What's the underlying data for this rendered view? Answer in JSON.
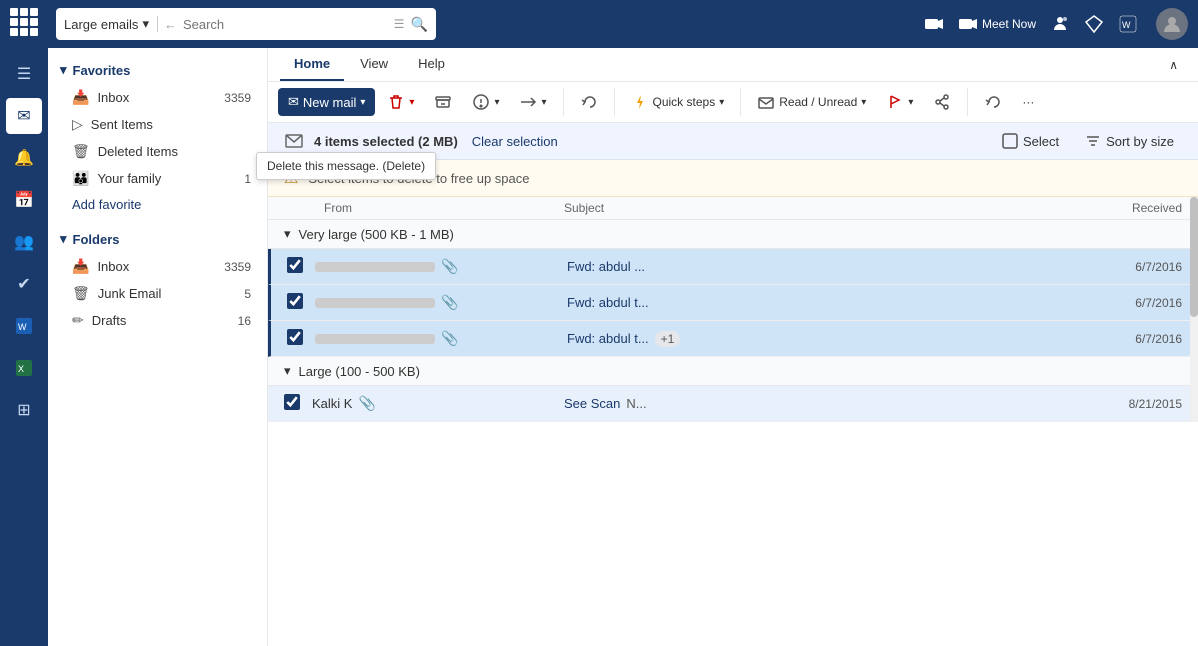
{
  "topbar": {
    "search_filter": "Large emails",
    "search_placeholder": "Search",
    "meet_now_label": "Meet Now",
    "icons": [
      "video-icon",
      "teams-icon",
      "diamond-icon",
      "word-icon"
    ]
  },
  "ribbon": {
    "tabs": [
      "Home",
      "View",
      "Help"
    ],
    "active_tab": "Home",
    "new_mail_label": "New mail",
    "delete_tooltip": "Delete this message. (Delete)",
    "archive_label": "Archive",
    "junk_label": "Junk",
    "move_label": "Move",
    "undo_label": "Undo",
    "quick_steps_label": "Quick steps",
    "read_unread_label": "Read / Unread",
    "flag_label": "Flag",
    "more_label": "More"
  },
  "selection_bar": {
    "count_text": "4 items selected (2 MB)",
    "clear_label": "Clear selection",
    "select_label": "Select",
    "sort_label": "Sort by size"
  },
  "alert": {
    "text": "Select items to delete to free up space"
  },
  "columns": {
    "from": "From",
    "subject": "Subject",
    "received": "Received"
  },
  "groups": [
    {
      "label": "Very large (500 KB - 1 MB)",
      "emails": [
        {
          "checked": true,
          "subject": "Fwd: abdul ...",
          "date": "6/7/2016",
          "has_attach": true,
          "sender_redacted": true
        },
        {
          "checked": true,
          "subject": "Fwd: abdul t...",
          "date": "6/7/2016",
          "has_attach": true,
          "sender_redacted": true
        },
        {
          "checked": true,
          "subject": "Fwd: abdul t...",
          "date": "6/7/2016",
          "has_attach": true,
          "sender_redacted": true,
          "more": "+1"
        }
      ]
    },
    {
      "label": "Large (100 - 500 KB)",
      "emails": [
        {
          "checked": true,
          "sender": "Kalki K",
          "subject": "See Scan",
          "subject2": "N...",
          "date": "8/21/2015",
          "has_attach": true
        }
      ]
    }
  ],
  "sidebar": {
    "favorites_label": "Favorites",
    "inbox_label": "Inbox",
    "inbox_count": "3359",
    "sent_label": "Sent Items",
    "deleted_label": "Deleted Items",
    "your_family_label": "Your family",
    "your_family_count": "1",
    "add_fav_label": "Add favorite",
    "folders_label": "Folders",
    "folders_inbox_label": "Inbox",
    "folders_inbox_count": "3359",
    "junk_label": "Junk Email",
    "junk_count": "5",
    "drafts_label": "Drafts",
    "drafts_count": "16"
  }
}
